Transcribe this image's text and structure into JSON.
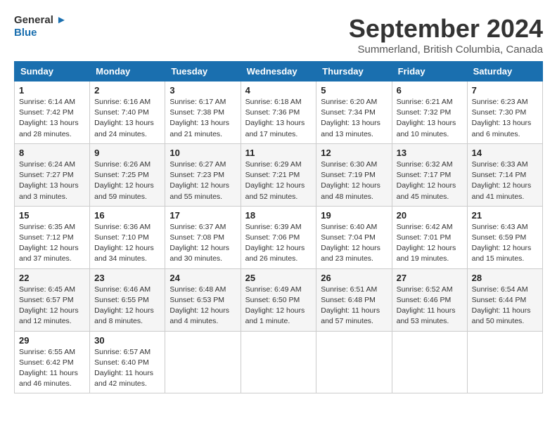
{
  "header": {
    "logo_line1": "General",
    "logo_line2": "Blue",
    "month_title": "September 2024",
    "subtitle": "Summerland, British Columbia, Canada"
  },
  "columns": [
    "Sunday",
    "Monday",
    "Tuesday",
    "Wednesday",
    "Thursday",
    "Friday",
    "Saturday"
  ],
  "weeks": [
    [
      {
        "day": "1",
        "info": "Sunrise: 6:14 AM\nSunset: 7:42 PM\nDaylight: 13 hours\nand 28 minutes."
      },
      {
        "day": "2",
        "info": "Sunrise: 6:16 AM\nSunset: 7:40 PM\nDaylight: 13 hours\nand 24 minutes."
      },
      {
        "day": "3",
        "info": "Sunrise: 6:17 AM\nSunset: 7:38 PM\nDaylight: 13 hours\nand 21 minutes."
      },
      {
        "day": "4",
        "info": "Sunrise: 6:18 AM\nSunset: 7:36 PM\nDaylight: 13 hours\nand 17 minutes."
      },
      {
        "day": "5",
        "info": "Sunrise: 6:20 AM\nSunset: 7:34 PM\nDaylight: 13 hours\nand 13 minutes."
      },
      {
        "day": "6",
        "info": "Sunrise: 6:21 AM\nSunset: 7:32 PM\nDaylight: 13 hours\nand 10 minutes."
      },
      {
        "day": "7",
        "info": "Sunrise: 6:23 AM\nSunset: 7:30 PM\nDaylight: 13 hours\nand 6 minutes."
      }
    ],
    [
      {
        "day": "8",
        "info": "Sunrise: 6:24 AM\nSunset: 7:27 PM\nDaylight: 13 hours\nand 3 minutes."
      },
      {
        "day": "9",
        "info": "Sunrise: 6:26 AM\nSunset: 7:25 PM\nDaylight: 12 hours\nand 59 minutes."
      },
      {
        "day": "10",
        "info": "Sunrise: 6:27 AM\nSunset: 7:23 PM\nDaylight: 12 hours\nand 55 minutes."
      },
      {
        "day": "11",
        "info": "Sunrise: 6:29 AM\nSunset: 7:21 PM\nDaylight: 12 hours\nand 52 minutes."
      },
      {
        "day": "12",
        "info": "Sunrise: 6:30 AM\nSunset: 7:19 PM\nDaylight: 12 hours\nand 48 minutes."
      },
      {
        "day": "13",
        "info": "Sunrise: 6:32 AM\nSunset: 7:17 PM\nDaylight: 12 hours\nand 45 minutes."
      },
      {
        "day": "14",
        "info": "Sunrise: 6:33 AM\nSunset: 7:14 PM\nDaylight: 12 hours\nand 41 minutes."
      }
    ],
    [
      {
        "day": "15",
        "info": "Sunrise: 6:35 AM\nSunset: 7:12 PM\nDaylight: 12 hours\nand 37 minutes."
      },
      {
        "day": "16",
        "info": "Sunrise: 6:36 AM\nSunset: 7:10 PM\nDaylight: 12 hours\nand 34 minutes."
      },
      {
        "day": "17",
        "info": "Sunrise: 6:37 AM\nSunset: 7:08 PM\nDaylight: 12 hours\nand 30 minutes."
      },
      {
        "day": "18",
        "info": "Sunrise: 6:39 AM\nSunset: 7:06 PM\nDaylight: 12 hours\nand 26 minutes."
      },
      {
        "day": "19",
        "info": "Sunrise: 6:40 AM\nSunset: 7:04 PM\nDaylight: 12 hours\nand 23 minutes."
      },
      {
        "day": "20",
        "info": "Sunrise: 6:42 AM\nSunset: 7:01 PM\nDaylight: 12 hours\nand 19 minutes."
      },
      {
        "day": "21",
        "info": "Sunrise: 6:43 AM\nSunset: 6:59 PM\nDaylight: 12 hours\nand 15 minutes."
      }
    ],
    [
      {
        "day": "22",
        "info": "Sunrise: 6:45 AM\nSunset: 6:57 PM\nDaylight: 12 hours\nand 12 minutes."
      },
      {
        "day": "23",
        "info": "Sunrise: 6:46 AM\nSunset: 6:55 PM\nDaylight: 12 hours\nand 8 minutes."
      },
      {
        "day": "24",
        "info": "Sunrise: 6:48 AM\nSunset: 6:53 PM\nDaylight: 12 hours\nand 4 minutes."
      },
      {
        "day": "25",
        "info": "Sunrise: 6:49 AM\nSunset: 6:50 PM\nDaylight: 12 hours\nand 1 minute."
      },
      {
        "day": "26",
        "info": "Sunrise: 6:51 AM\nSunset: 6:48 PM\nDaylight: 11 hours\nand 57 minutes."
      },
      {
        "day": "27",
        "info": "Sunrise: 6:52 AM\nSunset: 6:46 PM\nDaylight: 11 hours\nand 53 minutes."
      },
      {
        "day": "28",
        "info": "Sunrise: 6:54 AM\nSunset: 6:44 PM\nDaylight: 11 hours\nand 50 minutes."
      }
    ],
    [
      {
        "day": "29",
        "info": "Sunrise: 6:55 AM\nSunset: 6:42 PM\nDaylight: 11 hours\nand 46 minutes."
      },
      {
        "day": "30",
        "info": "Sunrise: 6:57 AM\nSunset: 6:40 PM\nDaylight: 11 hours\nand 42 minutes."
      },
      {
        "day": "",
        "info": ""
      },
      {
        "day": "",
        "info": ""
      },
      {
        "day": "",
        "info": ""
      },
      {
        "day": "",
        "info": ""
      },
      {
        "day": "",
        "info": ""
      }
    ]
  ]
}
